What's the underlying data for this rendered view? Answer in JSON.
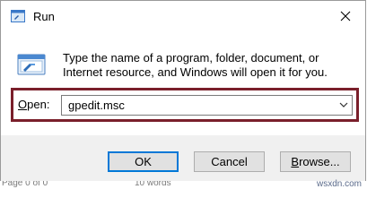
{
  "window": {
    "title": "Run",
    "icons": {
      "app": "run-app-icon",
      "close": "close-icon",
      "dialog": "run-dialog-icon"
    }
  },
  "dialog": {
    "description": "Type the name of a program, folder, document, or Internet resource, and Windows will open it for you.",
    "open_label_prefix": "",
    "open_label_accel": "O",
    "open_label_rest": "pen:",
    "input_value": "gpedit.msc",
    "highlight_color": "#7a1f2b"
  },
  "buttons": {
    "ok": "OK",
    "cancel": "Cancel",
    "browse_accel": "B",
    "browse_rest": "rowse..."
  },
  "background_fragments": {
    "left": "Page 0 of 0",
    "middle": "10 words"
  },
  "watermark": "wsxdn.com"
}
